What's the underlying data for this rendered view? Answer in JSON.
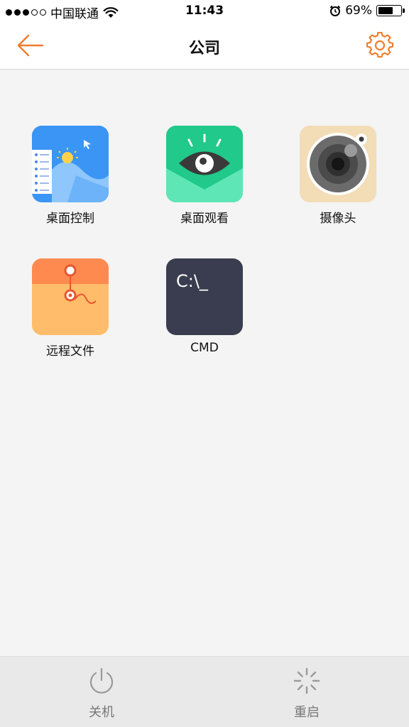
{
  "status_bar": {
    "carrier": "中国联通",
    "time": "11:43",
    "battery": "69%",
    "battery_level": 0.69,
    "signal_bars": 3,
    "signal_total": 5
  },
  "nav": {
    "title": "公司",
    "back_icon": "back-arrow-icon",
    "settings_icon": "gear-icon",
    "accent_color": "#f07c2a"
  },
  "apps": [
    {
      "label": "桌面控制",
      "icon": "desktop-control-icon"
    },
    {
      "label": "桌面观看",
      "icon": "eye-icon"
    },
    {
      "label": "摄像头",
      "icon": "camera-icon"
    },
    {
      "label": "远程文件",
      "icon": "zip-file-icon"
    },
    {
      "label": "CMD",
      "icon": "terminal-icon",
      "prompt_text": "C:\\_"
    }
  ],
  "bottom_bar": {
    "shutdown_label": "关机",
    "restart_label": "重启"
  }
}
